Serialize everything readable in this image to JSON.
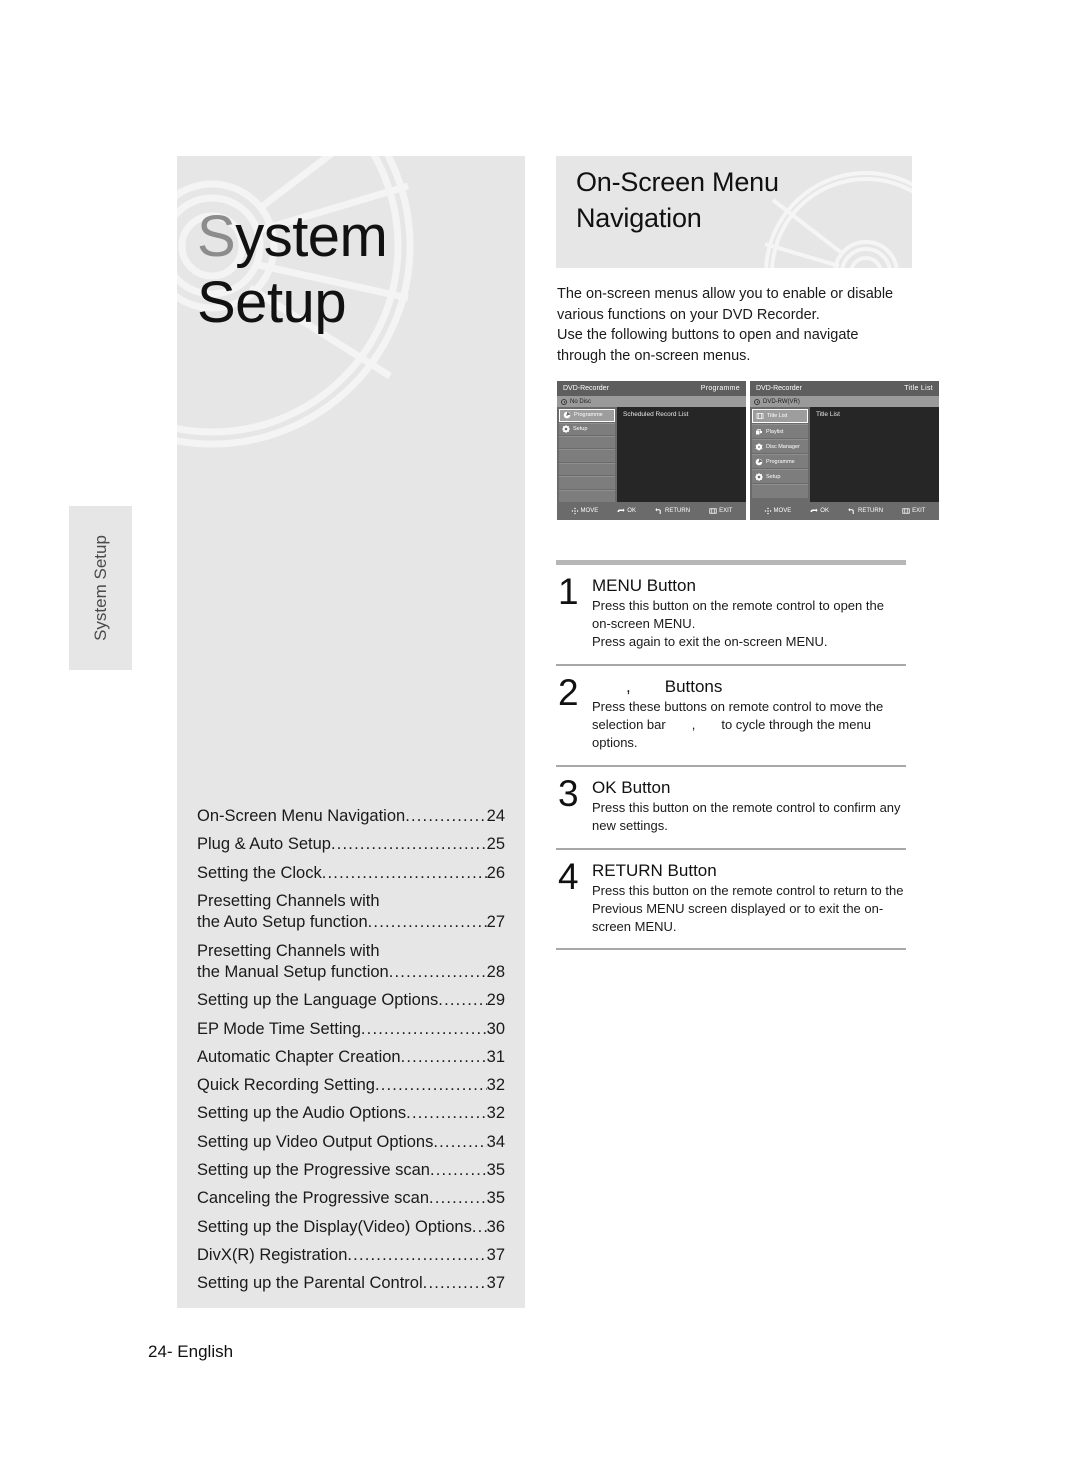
{
  "chapter": {
    "title_dim": "S",
    "title_rest": "ystem\nSetup",
    "title_full": "System\nSetup",
    "side_tab_lead": "Sy",
    "side_tab_label": "System Setup"
  },
  "section": {
    "title": "On-Screen Menu\nNavigation",
    "intro": "The on-screen menus allow you to enable or disable various functions on your DVD Recorder.\nUse the following buttons to open and navigate through the on-screen menus."
  },
  "screens": [
    {
      "name": "programme-screen",
      "titlebar_left": "DVD-Recorder",
      "titlebar_right": "Programme",
      "disc_label": "No Disc",
      "menu_items": [
        {
          "label": "Programme",
          "icon": "programme-icon",
          "selected": true
        },
        {
          "label": "Setup",
          "icon": "gear-icon",
          "selected": false
        },
        {
          "label": "",
          "icon": "",
          "selected": false
        },
        {
          "label": "",
          "icon": "",
          "selected": false
        },
        {
          "label": "",
          "icon": "",
          "selected": false
        },
        {
          "label": "",
          "icon": "",
          "selected": false
        },
        {
          "label": "",
          "icon": "",
          "selected": false
        }
      ],
      "content": "Scheduled Record List",
      "footer": [
        {
          "label": "MOVE",
          "icon": "dpad-icon"
        },
        {
          "label": "OK",
          "icon": "ok-icon"
        },
        {
          "label": "RETURN",
          "icon": "return-icon"
        },
        {
          "label": "EXIT",
          "icon": "exit-icon"
        }
      ]
    },
    {
      "name": "title-list-screen",
      "titlebar_left": "DVD-Recorder",
      "titlebar_right": "Title List",
      "disc_label": "DVD-RW(VR)",
      "menu_items": [
        {
          "label": "Title List",
          "icon": "title-list-icon",
          "selected": true
        },
        {
          "label": "Playlist",
          "icon": "playlist-icon",
          "selected": false
        },
        {
          "label": "Disc Manager",
          "icon": "disc-manager-icon",
          "selected": false
        },
        {
          "label": "Programme",
          "icon": "programme-icon",
          "selected": false
        },
        {
          "label": "Setup",
          "icon": "gear-icon",
          "selected": false
        },
        {
          "label": "",
          "icon": "",
          "selected": false
        }
      ],
      "content": "Title List",
      "footer": [
        {
          "label": "MOVE",
          "icon": "dpad-icon"
        },
        {
          "label": "OK",
          "icon": "ok-icon"
        },
        {
          "label": "RETURN",
          "icon": "return-icon"
        },
        {
          "label": "EXIT",
          "icon": "exit-icon"
        }
      ]
    }
  ],
  "steps": [
    {
      "number": "1",
      "title": "MENU Button",
      "title_prefix": "",
      "title_suffix": "",
      "text": "Press this button on the remote control to open the on-screen MENU.\nPress again to exit the on-screen MENU."
    },
    {
      "number": "2",
      "title": "Buttons",
      "title_prefix": "",
      "title_suffix": ",",
      "text": "Press these buttons on remote control to move the selection bar",
      "text2": ",",
      "text3": "to cycle through the menu options."
    },
    {
      "number": "3",
      "title": "OK Button",
      "text": "Press this button on the remote control to confirm any new settings."
    },
    {
      "number": "4",
      "title": "RETURN Button",
      "text": "Press this button on the remote control to return to the Previous MENU screen displayed or to exit the on-screen MENU."
    }
  ],
  "toc": [
    {
      "label": "On-Screen Menu Navigation",
      "label2": "",
      "page": "24"
    },
    {
      "label": "Plug & Auto Setup",
      "label2": "",
      "page": "25"
    },
    {
      "label": "Setting the Clock",
      "label2": "",
      "page": "26"
    },
    {
      "label": "Presetting Channels with",
      "label2": "the Auto Setup function",
      "page": "27"
    },
    {
      "label": "Presetting Channels with",
      "label2": "the Manual Setup function",
      "page": "28"
    },
    {
      "label": "Setting up the Language Options",
      "label2": "",
      "page": "29"
    },
    {
      "label": "EP Mode Time Setting",
      "label2": "",
      "page": "30"
    },
    {
      "label": "Automatic Chapter Creation",
      "label2": "",
      "page": "31"
    },
    {
      "label": "Quick Recording Setting",
      "label2": "",
      "page": "32"
    },
    {
      "label": "Setting up the Audio Options",
      "label2": "",
      "page": "32"
    },
    {
      "label": "Setting up Video Output Options",
      "label2": "",
      "page": "34"
    },
    {
      "label": "Setting up the Progressive scan",
      "label2": "",
      "page": "35"
    },
    {
      "label": "Canceling the Progressive scan",
      "label2": "",
      "page": "35"
    },
    {
      "label": "Setting up the Display(Video) Options",
      "label2": "",
      "page": "36"
    },
    {
      "label": "DivX(R) Registration",
      "label2": "",
      "page": "37"
    },
    {
      "label": "Setting up the Parental Control",
      "label2": "",
      "page": "37"
    }
  ],
  "footer": {
    "page_label": "24- English"
  },
  "colors": {
    "panel_gray": "#e6e6e6",
    "rule_gray": "#b7b7b7",
    "tv_dark": "#262626",
    "tv_chrome": "#6b6b6b"
  }
}
